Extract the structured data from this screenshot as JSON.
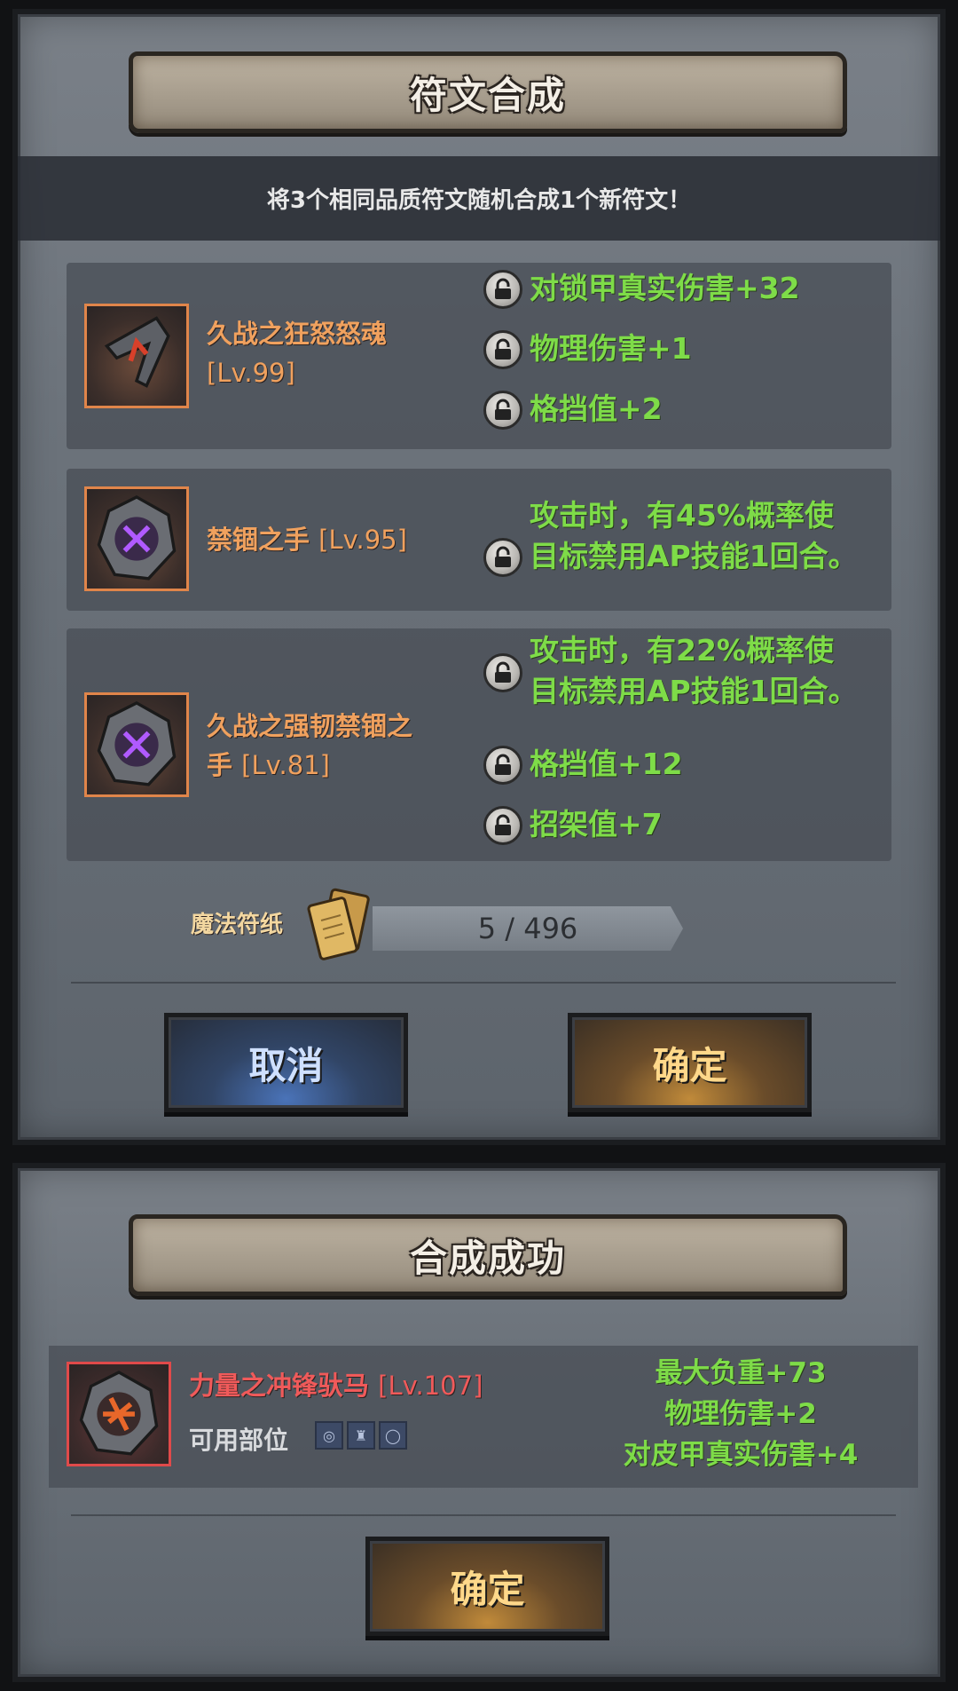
{
  "synthesis": {
    "title": "符文合成",
    "subtitle": "将3个相同品质符文随机合成1个新符文！",
    "runes": [
      {
        "name": "久战之狂怒怒魂",
        "level": "[Lv.99]",
        "icon": "red-arrow-rune-icon",
        "stats": [
          "对锁甲真实伤害+32",
          "物理伤害+1",
          "格挡值+2"
        ]
      },
      {
        "name": "禁锢之手",
        "level": "[Lv.95]",
        "icon": "purple-cross-rune-icon",
        "stats": [
          "攻击时，有45%概率使\n目标禁用AP技能1回合。"
        ]
      },
      {
        "name": "久战之强韧禁锢之",
        "name2": "手",
        "level": "[Lv.81]",
        "icon": "purple-cross-rune-icon",
        "stats": [
          "攻击时，有22%概率使\n目标禁用AP技能1回合。",
          "格挡值+12",
          "招架值+7"
        ]
      }
    ],
    "material_label": "魔法符纸",
    "material_count": "5 / 496",
    "cancel_label": "取消",
    "confirm_label": "确定"
  },
  "result": {
    "title": "合成成功",
    "rune_name": "力量之冲锋驮马",
    "rune_level": "[Lv.107]",
    "slot_label": "可用部位",
    "stats": [
      "最大负重+73",
      "物理伤害+2",
      "对皮甲真实伤害+4"
    ],
    "confirm_label": "确定"
  },
  "colors": {
    "stat_green": "#7edc48",
    "orange_name": "#f0a15e",
    "red_name": "#f05a5a"
  }
}
